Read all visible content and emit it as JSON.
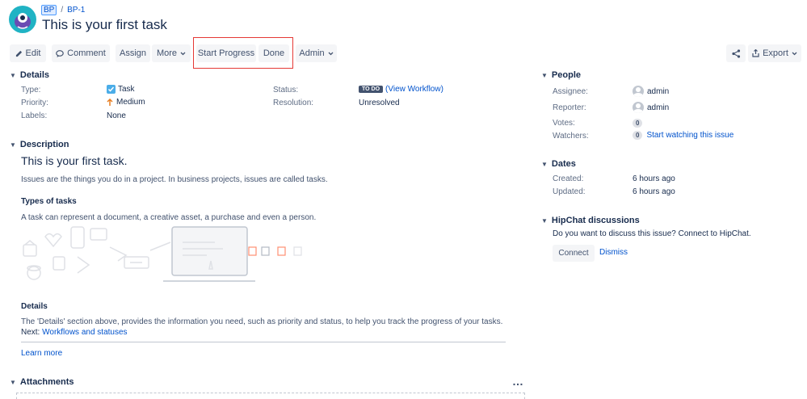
{
  "header": {
    "project_key": "BP",
    "breadcrumb_sep": "/",
    "issue_key": "BP-1",
    "title": "This is your first task"
  },
  "toolbar": {
    "edit": "Edit",
    "comment": "Comment",
    "assign": "Assign",
    "more": "More",
    "start_progress": "Start Progress",
    "done": "Done",
    "admin": "Admin",
    "export": "Export"
  },
  "details": {
    "title": "Details",
    "type_label": "Type:",
    "type_value": "Task",
    "priority_label": "Priority:",
    "priority_value": "Medium",
    "labels_label": "Labels:",
    "labels_value": "None",
    "status_label": "Status:",
    "status_badge": "TO DO",
    "view_workflow": "(View Workflow)",
    "resolution_label": "Resolution:",
    "resolution_value": "Unresolved"
  },
  "description": {
    "title": "Description",
    "heading": "This is your first task.",
    "intro": "Issues are the things you do in a project. In business projects, issues are called tasks.",
    "types_heading": "Types of tasks",
    "types_text": "A task can represent a document, a creative asset, a purchase and even a person.",
    "details_heading": "Details",
    "details_text": "The 'Details' section above, provides the information you need, such as priority and status, to help you track the progress of your tasks.",
    "next_label": "Next:",
    "next_link": "Workflows and statuses",
    "learn_more": "Learn more"
  },
  "attachments": {
    "title": "Attachments",
    "more": "…"
  },
  "people": {
    "title": "People",
    "assignee_label": "Assignee:",
    "assignee_value": "admin",
    "reporter_label": "Reporter:",
    "reporter_value": "admin",
    "votes_label": "Votes:",
    "votes_count": "0",
    "watchers_label": "Watchers:",
    "watchers_count": "0",
    "watch_link": "Start watching this issue"
  },
  "dates": {
    "title": "Dates",
    "created_label": "Created:",
    "created_value": "6 hours ago",
    "updated_label": "Updated:",
    "updated_value": "6 hours ago"
  },
  "hipchat": {
    "title": "HipChat discussions",
    "text": "Do you want to discuss this issue? Connect to HipChat.",
    "connect": "Connect",
    "dismiss": "Dismiss"
  },
  "colors": {
    "link": "#0052cc",
    "highlight_box": "#e53935",
    "todo_badge": "#42526e",
    "priority_medium": "#e77e22",
    "task_icon": "#4bade8"
  }
}
